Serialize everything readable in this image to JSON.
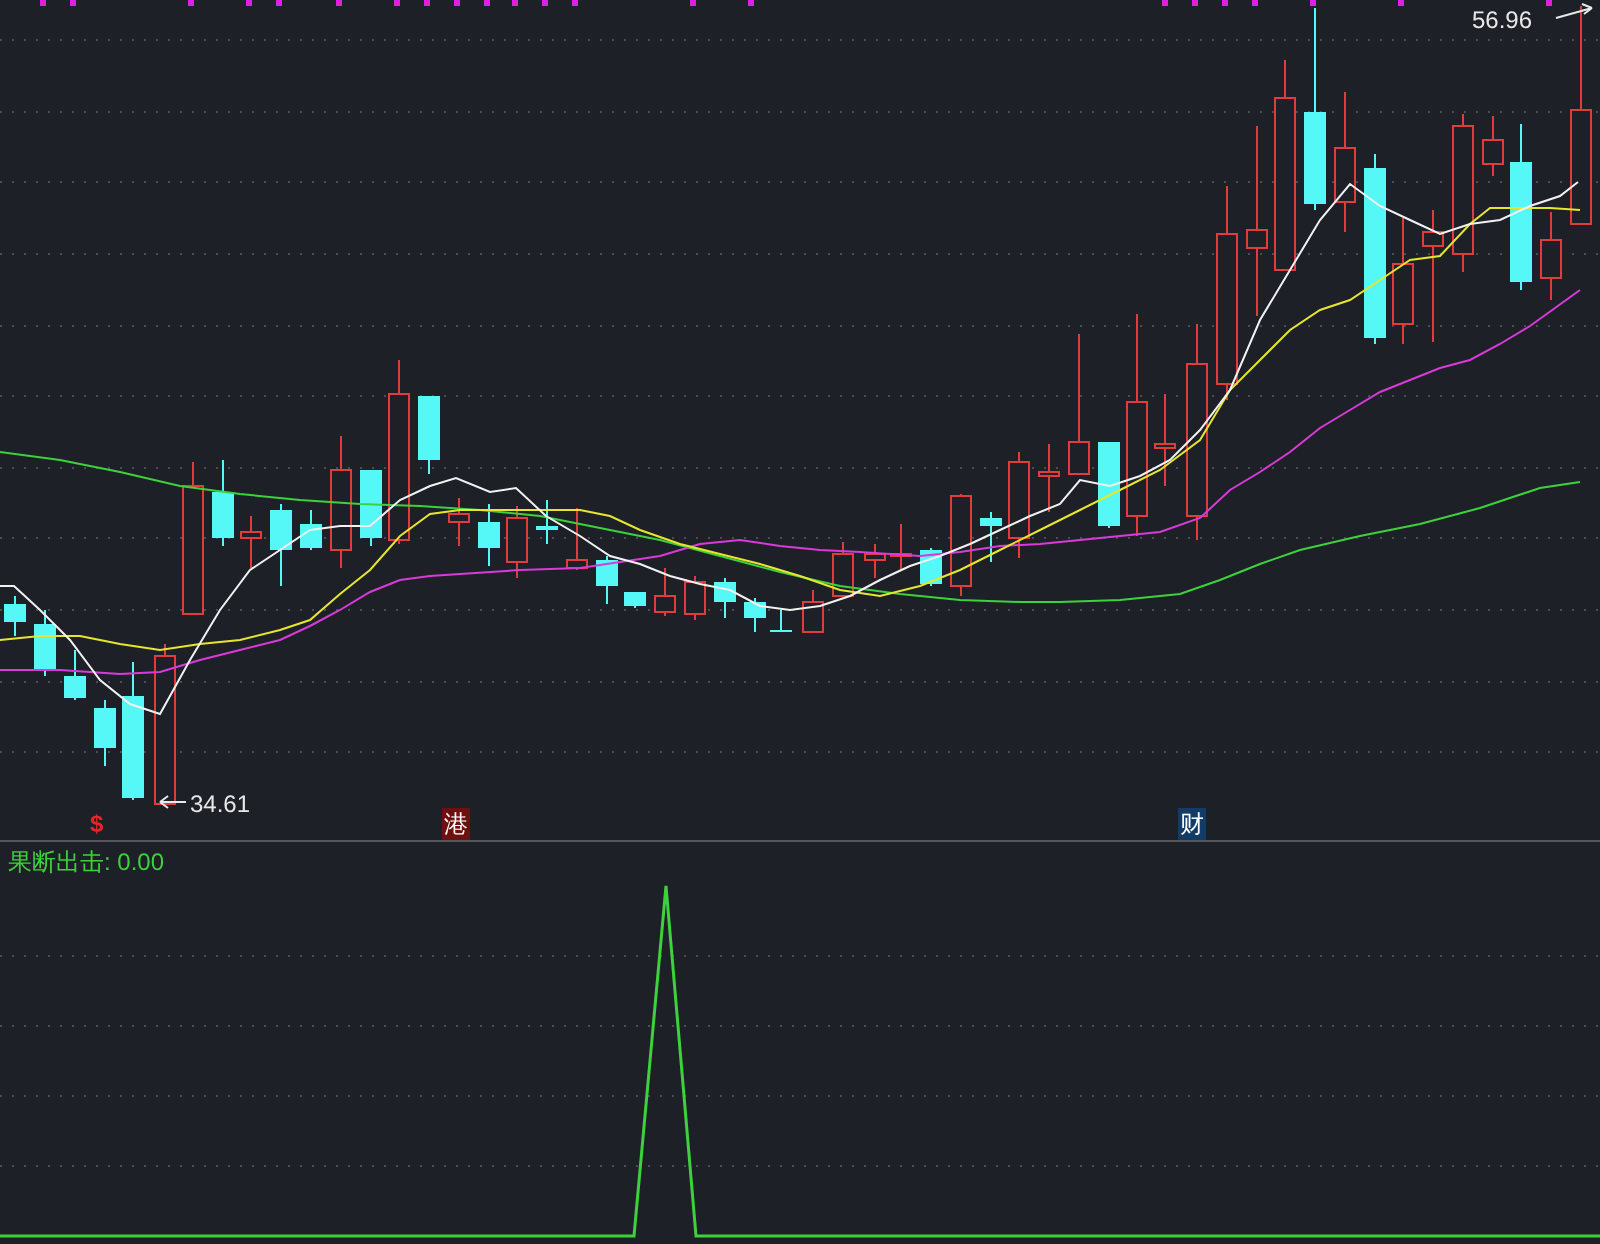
{
  "price_chart": {
    "high_label": "56.96",
    "low_label": "34.61",
    "markers": [
      {
        "text": "$",
        "kind": "plain",
        "color": "#e8242a"
      },
      {
        "text": "港",
        "kind": "boxed",
        "color": "#6e1010"
      },
      {
        "text": "财",
        "kind": "boxed",
        "color": "#123c66"
      }
    ]
  },
  "indicator_panel": {
    "label": "果断出击: 0.00"
  }
}
